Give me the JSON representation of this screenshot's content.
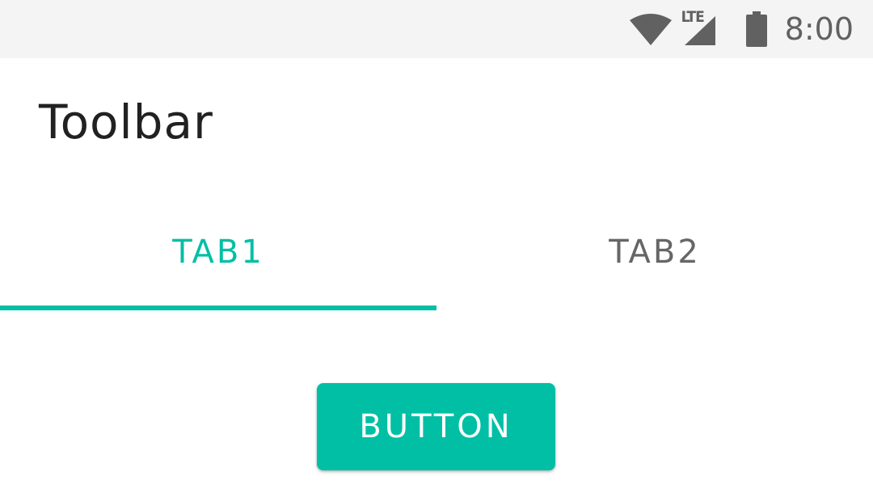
{
  "status_bar": {
    "network_type": "LTE",
    "time": "8:00",
    "icons": [
      "wifi-icon",
      "cellular-signal-icon",
      "battery-icon"
    ],
    "icon_color": "#616161",
    "background": "#f4f4f4"
  },
  "toolbar": {
    "title": "Toolbar"
  },
  "tabs": [
    {
      "label": "TAB1",
      "selected": true
    },
    {
      "label": "TAB2",
      "selected": false
    }
  ],
  "main": {
    "button_label": "BUTTON"
  },
  "colors": {
    "accent": "#00bfa5",
    "inactive_tab_text": "#666666",
    "title_text": "#212121"
  }
}
